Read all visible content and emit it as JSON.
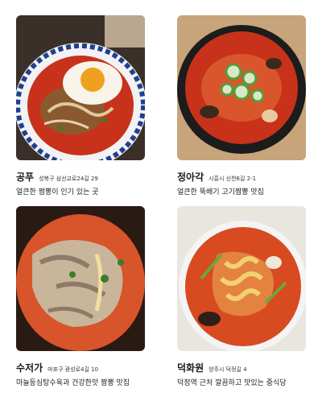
{
  "restaurants": [
    {
      "name": "공푸",
      "address": "성북구 삼선교로24길 29",
      "description": "얼큰한 짬뽕이 인기 있는 곳",
      "image": "jjamppong-with-fried-egg-photo"
    },
    {
      "name": "정아각",
      "address": "시흥시 신천6길 2-1",
      "description": "얼큰한 뚝배기 고기짬뽕 맛집",
      "image": "ttukbaegi-jjamppong-photo"
    },
    {
      "name": "수저가",
      "address": "마포구 광성로4길 10",
      "description": "마늘등심탕수육과 건강한맛 짬뽕 맛집",
      "image": "pork-jjamppong-photo"
    },
    {
      "name": "덕화원",
      "address": "양주시 덕정길 4",
      "description": "덕정역 근처 깔끔하고 맛있는 중식당",
      "image": "seafood-jjamppong-photo"
    }
  ],
  "colors": {
    "broth": "#c8321a",
    "bowl_rim": "#1f3f8f",
    "black_bowl": "#1c1c1c"
  }
}
